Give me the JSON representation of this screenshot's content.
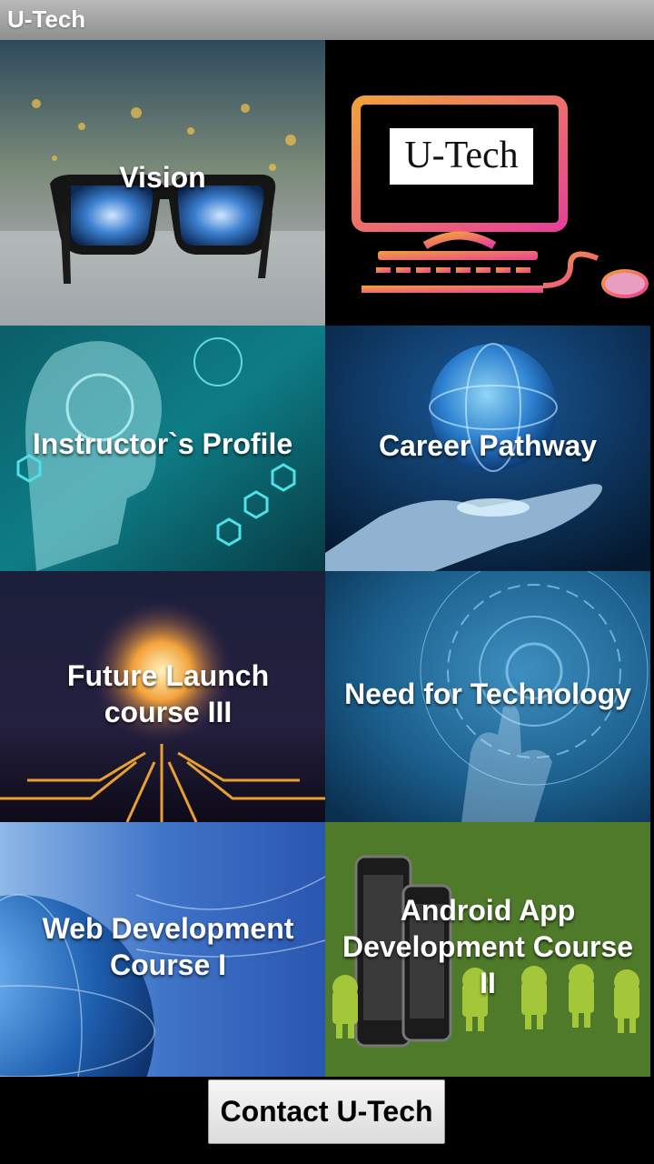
{
  "app": {
    "title": "U-Tech"
  },
  "tiles": [
    {
      "label": "Vision"
    },
    {
      "label": "",
      "logo_text": "U-Tech"
    },
    {
      "label": "Instructor`s Profile"
    },
    {
      "label": "Career Pathway"
    },
    {
      "label": "Future Launch course III"
    },
    {
      "label": "Need for Technology"
    },
    {
      "label": "Web Development Course I"
    },
    {
      "label": "Android App Development Course II"
    }
  ],
  "contact_button": {
    "label": "Contact U-Tech"
  },
  "colors": {
    "titlebar": "#9e9e9e",
    "logo_gradient_start": "#f2a03a",
    "logo_gradient_end": "#e8409a",
    "android_green": "#4e7a2a"
  }
}
